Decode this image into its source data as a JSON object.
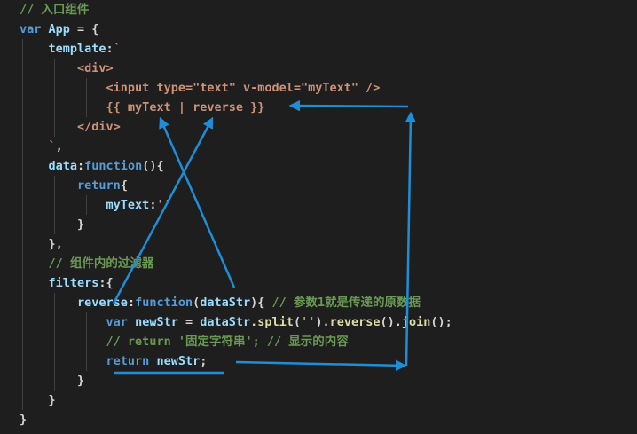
{
  "colors": {
    "background": "#1e1e1e",
    "comment": "#6a9955",
    "keyword": "#569cd6",
    "variable": "#9cdcfe",
    "text": "#d4d4d4",
    "string": "#ce9178",
    "tag": "#569cd6",
    "function": "#dcdcaa",
    "annotation": "#1e8ed8"
  },
  "code": {
    "lines": [
      [
        {
          "t": "// 入口组件",
          "c": "comment"
        }
      ],
      [
        {
          "t": "var",
          "c": "keyword"
        },
        {
          "t": " ",
          "c": "text"
        },
        {
          "t": "App",
          "c": "variable"
        },
        {
          "t": " = {",
          "c": "text"
        }
      ],
      [
        {
          "t": "    ",
          "c": "text"
        },
        {
          "t": "template",
          "c": "variable"
        },
        {
          "t": ":",
          "c": "text"
        },
        {
          "t": "`",
          "c": "string"
        }
      ],
      [
        {
          "t": "        ",
          "c": "text"
        },
        {
          "t": "<div>",
          "c": "string"
        }
      ],
      [
        {
          "t": "            ",
          "c": "text"
        },
        {
          "t": "<input type=\"text\" v-model=\"myText\" />",
          "c": "string"
        }
      ],
      [
        {
          "t": "            ",
          "c": "text"
        },
        {
          "t": "{{ myText | reverse }}",
          "c": "string"
        }
      ],
      [
        {
          "t": "        ",
          "c": "text"
        },
        {
          "t": "</div>",
          "c": "string"
        }
      ],
      [
        {
          "t": "    ",
          "c": "text"
        },
        {
          "t": "`",
          "c": "string"
        },
        {
          "t": ",",
          "c": "text"
        }
      ],
      [
        {
          "t": "    ",
          "c": "text"
        },
        {
          "t": "data",
          "c": "variable"
        },
        {
          "t": ":",
          "c": "text"
        },
        {
          "t": "function",
          "c": "keyword"
        },
        {
          "t": "(){",
          "c": "text"
        }
      ],
      [
        {
          "t": "        ",
          "c": "text"
        },
        {
          "t": "return",
          "c": "keyword"
        },
        {
          "t": "{",
          "c": "text"
        }
      ],
      [
        {
          "t": "            ",
          "c": "text"
        },
        {
          "t": "myText",
          "c": "variable"
        },
        {
          "t": ":",
          "c": "text"
        },
        {
          "t": "''",
          "c": "string"
        }
      ],
      [
        {
          "t": "        ",
          "c": "text"
        },
        {
          "t": "}",
          "c": "text"
        }
      ],
      [
        {
          "t": "    ",
          "c": "text"
        },
        {
          "t": "},",
          "c": "text"
        }
      ],
      [
        {
          "t": "    ",
          "c": "text"
        },
        {
          "t": "// 组件内的过滤器",
          "c": "comment"
        }
      ],
      [
        {
          "t": "    ",
          "c": "text"
        },
        {
          "t": "filters",
          "c": "variable"
        },
        {
          "t": ":{",
          "c": "text"
        }
      ],
      [
        {
          "t": "        ",
          "c": "text"
        },
        {
          "t": "reverse",
          "c": "variable"
        },
        {
          "t": ":",
          "c": "text"
        },
        {
          "t": "function",
          "c": "keyword"
        },
        {
          "t": "(",
          "c": "text"
        },
        {
          "t": "dataStr",
          "c": "variable"
        },
        {
          "t": "){ ",
          "c": "text"
        },
        {
          "t": "// 参数1就是传递的原数据",
          "c": "comment"
        }
      ],
      [
        {
          "t": "            ",
          "c": "text"
        },
        {
          "t": "var",
          "c": "keyword"
        },
        {
          "t": " ",
          "c": "text"
        },
        {
          "t": "newStr",
          "c": "variable"
        },
        {
          "t": " = ",
          "c": "text"
        },
        {
          "t": "dataStr",
          "c": "variable"
        },
        {
          "t": ".",
          "c": "text"
        },
        {
          "t": "split",
          "c": "function"
        },
        {
          "t": "(",
          "c": "text"
        },
        {
          "t": "''",
          "c": "string"
        },
        {
          "t": ").",
          "c": "text"
        },
        {
          "t": "reverse",
          "c": "function"
        },
        {
          "t": "().",
          "c": "text"
        },
        {
          "t": "join",
          "c": "function"
        },
        {
          "t": "();",
          "c": "text"
        }
      ],
      [
        {
          "t": "            ",
          "c": "text"
        },
        {
          "t": "// return '固定字符串'; // 显示的内容",
          "c": "comment"
        }
      ],
      [
        {
          "t": "            ",
          "c": "text"
        },
        {
          "t": "return",
          "c": "keyword"
        },
        {
          "t": " ",
          "c": "text"
        },
        {
          "t": "newStr",
          "c": "variable"
        },
        {
          "t": ";",
          "c": "text"
        }
      ],
      [
        {
          "t": "        ",
          "c": "text"
        },
        {
          "t": "}",
          "c": "text"
        }
      ],
      [
        {
          "t": "    ",
          "c": "text"
        },
        {
          "t": "}",
          "c": "text"
        }
      ],
      [
        {
          "t": "}",
          "c": "text"
        }
      ]
    ]
  }
}
